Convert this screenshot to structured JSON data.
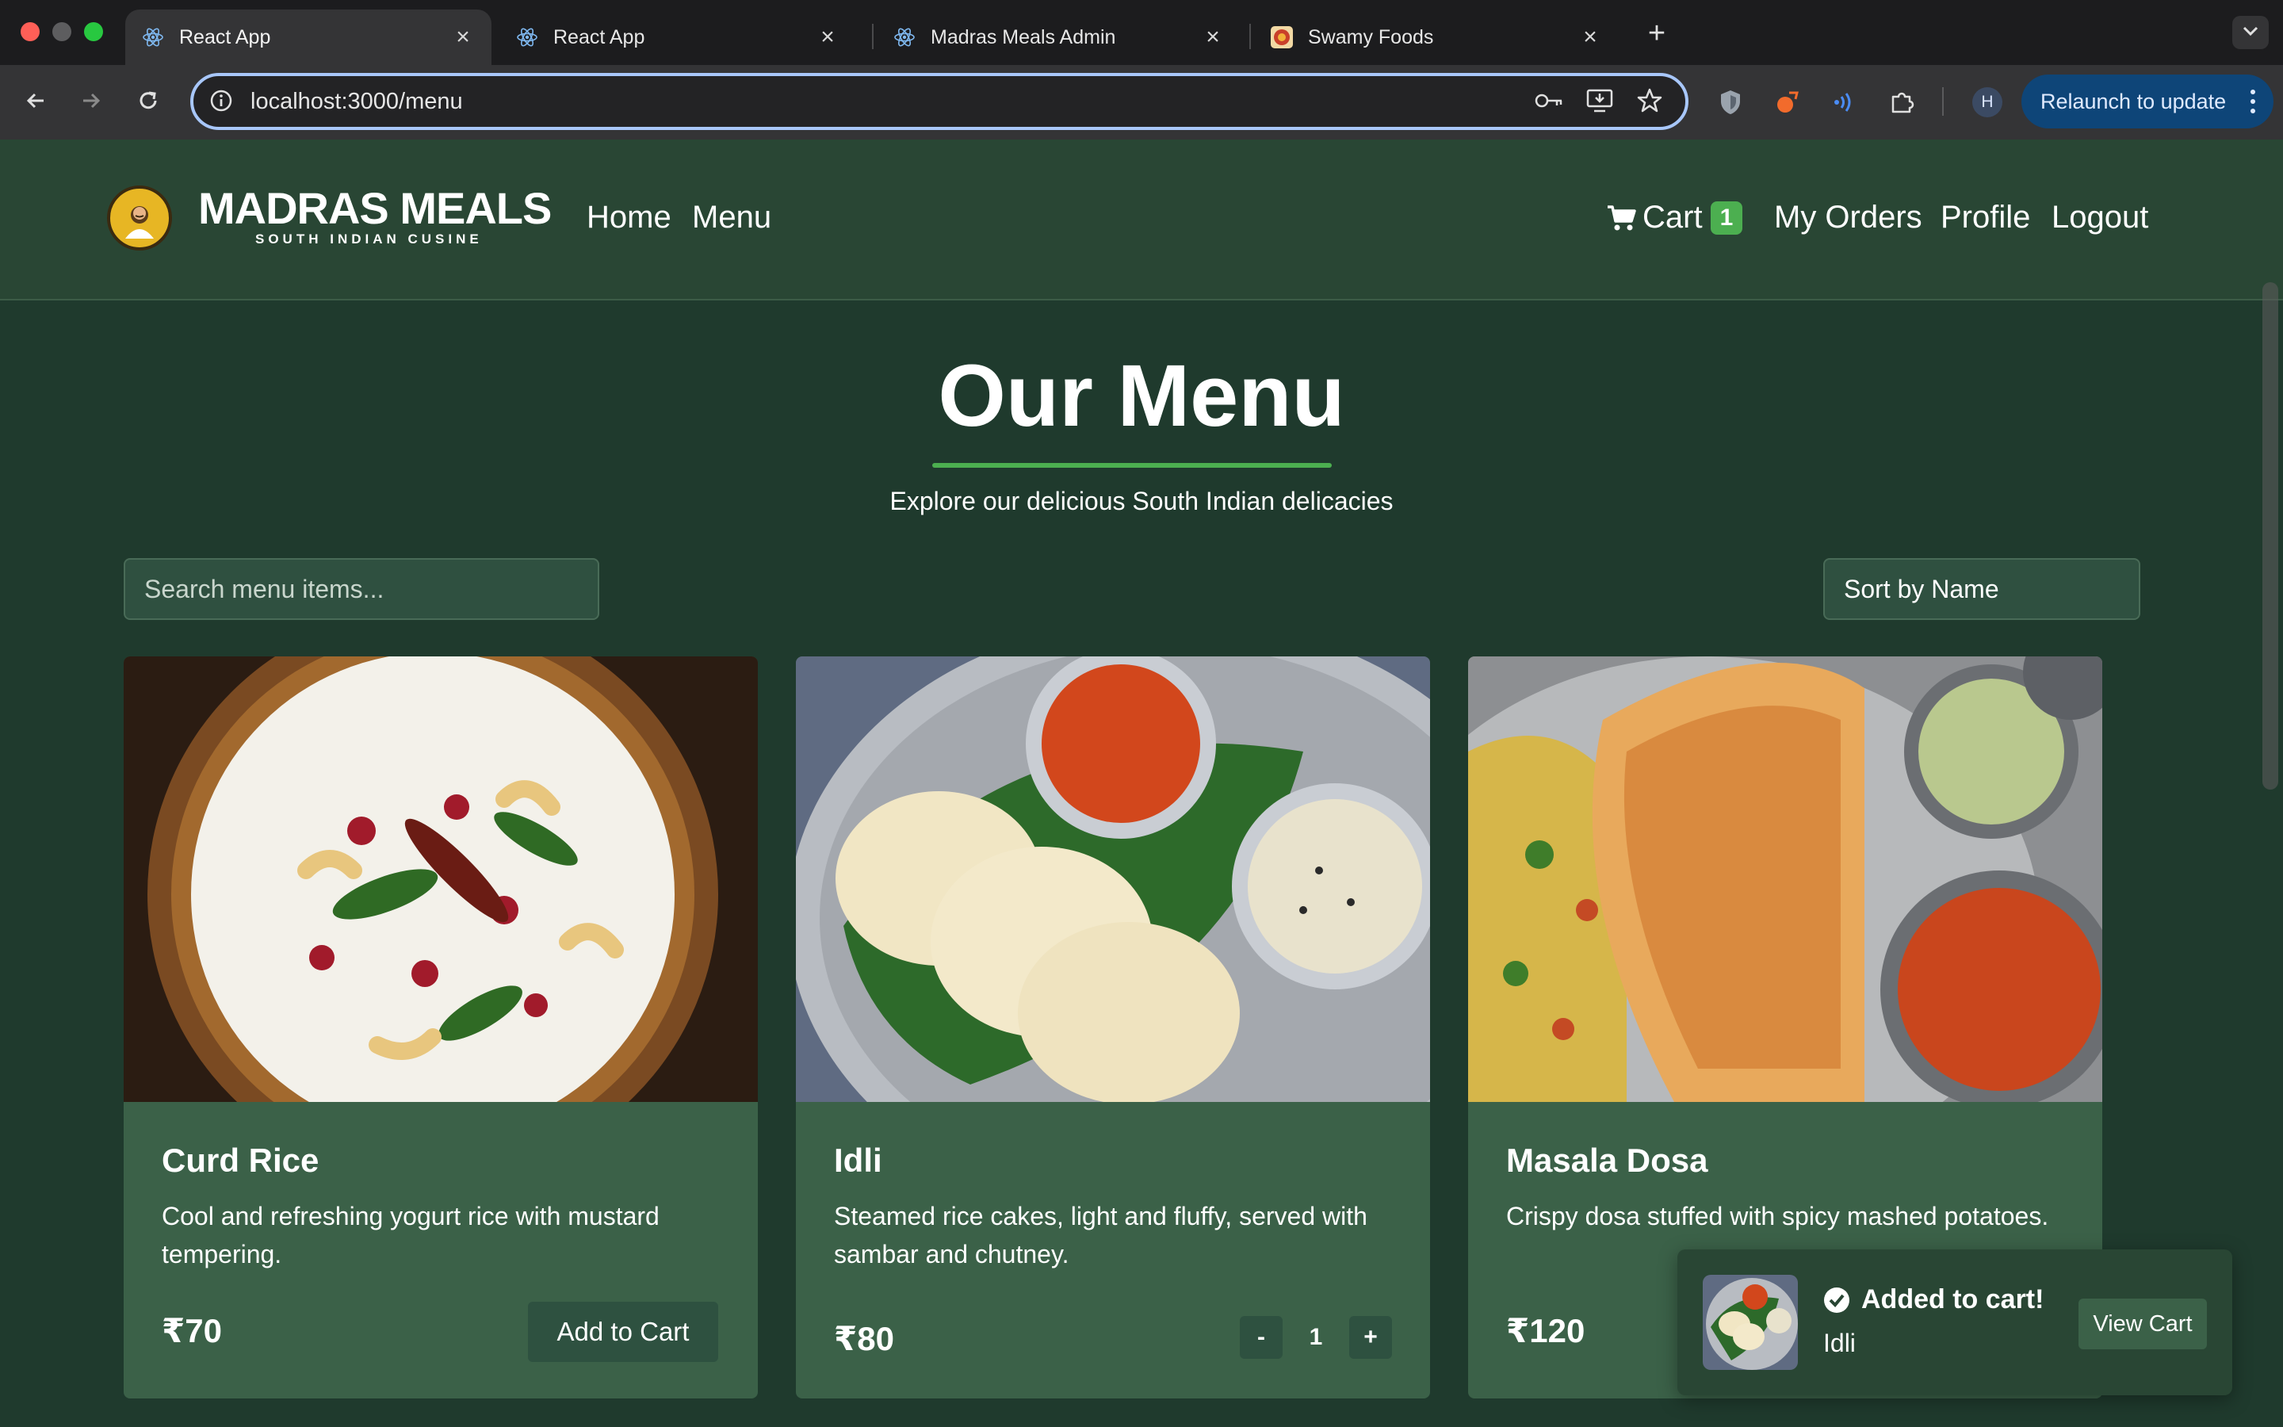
{
  "browser": {
    "tabs": [
      {
        "title": "React App",
        "icon": "react-icon",
        "active": true
      },
      {
        "title": "React App",
        "icon": "react-icon",
        "active": false
      },
      {
        "title": "Madras Meals Admin",
        "icon": "react-icon",
        "active": false
      },
      {
        "title": "Swamy Foods",
        "icon": "swamy-foods-icon",
        "active": false
      }
    ],
    "new_tab": "+",
    "url": "localhost:3000/menu",
    "profile_initial": "H",
    "relaunch_label": "Relaunch to update"
  },
  "header": {
    "brand": "MADRAS MEALS",
    "brand_sub": "SOUTH INDIAN CUSINE",
    "nav_left": [
      "Home",
      "Menu"
    ],
    "cart_label": "Cart",
    "cart_count": "1",
    "nav_right": [
      "My Orders",
      "Profile",
      "Logout"
    ]
  },
  "main": {
    "title": "Our Menu",
    "subtitle": "Explore our delicious South Indian delicacies",
    "search_placeholder": "Search menu items...",
    "sort_label": "Sort by Name"
  },
  "menu_items": [
    {
      "name": "Curd Rice",
      "description": "Cool and refreshing yogurt rice with mustard tempering.",
      "price": "₹70",
      "action": "Add to Cart"
    },
    {
      "name": "Idli",
      "description": "Steamed rice cakes, light and fluffy, served with sambar and chutney.",
      "price": "₹80",
      "quantity": "1",
      "minus": "-",
      "plus": "+"
    },
    {
      "name": "Masala Dosa",
      "description": "Crispy dosa stuffed with spicy mashed potatoes.",
      "price": "₹120"
    }
  ],
  "toast": {
    "title": "Added to cart!",
    "item": "Idli",
    "action": "View Cart"
  },
  "colors": {
    "page_bg": "#1f3a2d",
    "header_bg": "#294634",
    "card_bg": "#3b6148",
    "accent": "#4caf50",
    "relaunch_bg": "#0e4578"
  }
}
